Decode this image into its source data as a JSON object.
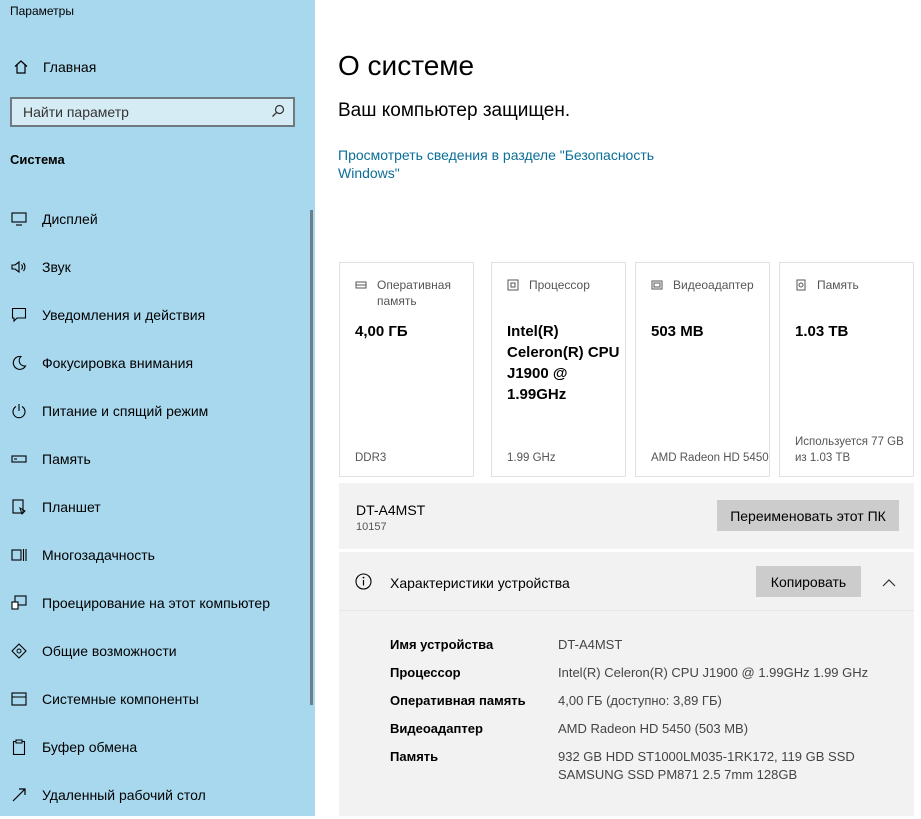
{
  "app": {
    "title": "Параметры"
  },
  "sidebar": {
    "home_label": "Главная",
    "search_placeholder": "Найти параметр",
    "section_title": "Система",
    "items": [
      {
        "label": "Дисплей",
        "icon": "display-icon"
      },
      {
        "label": "Звук",
        "icon": "speaker-icon"
      },
      {
        "label": "Уведомления и действия",
        "icon": "notification-icon"
      },
      {
        "label": "Фокусировка внимания",
        "icon": "moon-icon"
      },
      {
        "label": "Питание и спящий режим",
        "icon": "power-icon"
      },
      {
        "label": "Память",
        "icon": "storage-icon"
      },
      {
        "label": "Планшет",
        "icon": "tablet-icon"
      },
      {
        "label": "Многозадачность",
        "icon": "multitasking-icon"
      },
      {
        "label": "Проецирование на этот компьютер",
        "icon": "projector-icon"
      },
      {
        "label": "Общие возможности",
        "icon": "shared-icon"
      },
      {
        "label": "Системные компоненты",
        "icon": "components-icon"
      },
      {
        "label": "Буфер обмена",
        "icon": "clipboard-icon"
      },
      {
        "label": "Удаленный рабочий стол",
        "icon": "remote-desktop-icon"
      }
    ]
  },
  "main": {
    "title": "О системе",
    "protected_text": "Ваш компьютер защищен.",
    "security_link": "Просмотреть сведения в разделе \"Безопасность Windows\"",
    "cards": [
      {
        "label": "Оперативная память",
        "value": "4,00 ГБ",
        "sub": "DDR3",
        "icon": "ram-icon"
      },
      {
        "label": "Процессор",
        "value": "Intel(R) Celeron(R) CPU J1900 @ 1.99GHz",
        "sub": "1.99 GHz",
        "icon": "cpu-icon"
      },
      {
        "label": "Видеоадаптер",
        "value": "503 MB",
        "sub": "AMD Radeon HD 5450",
        "icon": "gpu-icon"
      },
      {
        "label": "Память",
        "value": "1.03 TB",
        "sub": "Используется 77 GB из 1.03 TB",
        "icon": "disk-icon"
      }
    ],
    "pc": {
      "name": "DT-A4MST",
      "build": "10157",
      "rename_label": "Переименовать этот ПК"
    },
    "specs": {
      "title": "Характеристики устройства",
      "copy_label": "Копировать",
      "rows": [
        {
          "key": "Имя устройства",
          "value": "DT-A4MST"
        },
        {
          "key": "Процессор",
          "value": "Intel(R) Celeron(R) CPU J1900 @ 1.99GHz 1.99 GHz"
        },
        {
          "key": "Оперативная память",
          "value": "4,00 ГБ (доступно: 3,89 ГБ)"
        },
        {
          "key": "Видеоадаптер",
          "value": "AMD Radeon HD 5450 (503 MB)"
        },
        {
          "key": "Память",
          "value": "932 GB HDD ST1000LM035-1RK172, 119 GB SSD SAMSUNG SSD PM871 2.5 7mm 128GB"
        }
      ]
    }
  },
  "colors": {
    "sidebar_bg": "#a8d8ee",
    "link": "#0b6e99",
    "button_bg": "#cccccc"
  }
}
